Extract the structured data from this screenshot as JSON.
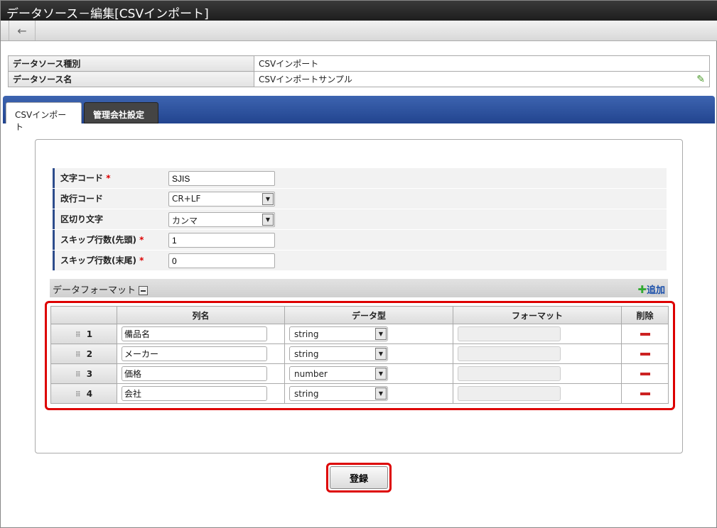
{
  "window": {
    "title": "データソース－編集[CSVインポート]"
  },
  "toolbar": {
    "back": "←"
  },
  "info": {
    "rows": [
      {
        "label": "データソース種別",
        "value": "CSVインポート"
      },
      {
        "label": "データソース名",
        "value": "CSVインポートサンプル"
      }
    ]
  },
  "tabs": [
    {
      "label": "CSVインポート",
      "active": true
    },
    {
      "label": "管理会社設定",
      "active": false
    }
  ],
  "form": {
    "charset": {
      "label": "文字コード",
      "required": "*",
      "value": "SJIS"
    },
    "newline": {
      "label": "改行コード",
      "value": "CR+LF"
    },
    "delimiter": {
      "label": "区切り文字",
      "value": "カンマ"
    },
    "skip_head": {
      "label": "スキップ行数(先頭)",
      "required": "*",
      "value": "1"
    },
    "skip_tail": {
      "label": "スキップ行数(末尾)",
      "required": "*",
      "value": "0"
    }
  },
  "data_format": {
    "title": "データフォーマット",
    "add_label": "追加",
    "headers": [
      "",
      "列名",
      "データ型",
      "フォーマット",
      "削除"
    ],
    "rows": [
      {
        "no": "1",
        "name": "備品名",
        "type": "string",
        "format": ""
      },
      {
        "no": "2",
        "name": "メーカー",
        "type": "string",
        "format": ""
      },
      {
        "no": "3",
        "name": "価格",
        "type": "number",
        "format": ""
      },
      {
        "no": "4",
        "name": "会社",
        "type": "string",
        "format": ""
      }
    ]
  },
  "submit_label": "登録"
}
